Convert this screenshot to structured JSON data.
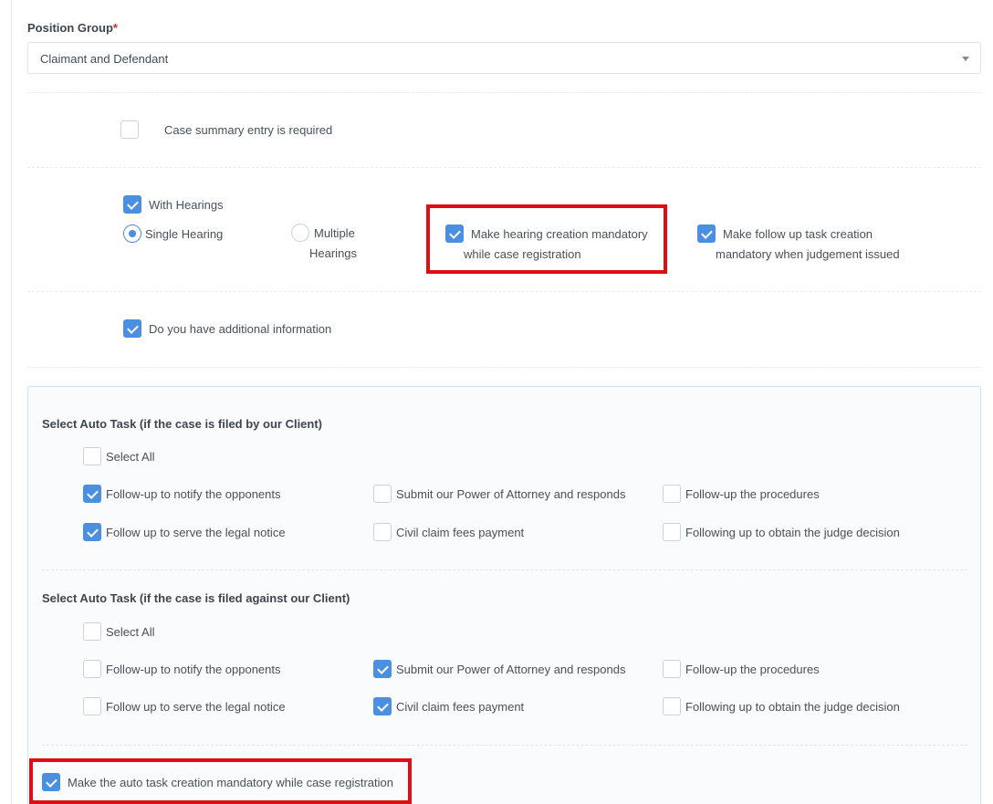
{
  "position_group": {
    "label": "Position Group",
    "required_mark": "*",
    "selected": "Claimant and Defendant"
  },
  "case_summary": {
    "label": "Case summary entry is required",
    "checked": false
  },
  "hearings": {
    "with_hearings": {
      "label": "With Hearings",
      "checked": true
    },
    "single_hearing": {
      "label": "Single Hearing",
      "selected": true
    },
    "multiple_hearings": {
      "line1": "Multiple",
      "line2": "Hearings",
      "selected": false
    },
    "mandatory_hearing": {
      "line1": "Make hearing creation mandatory",
      "line2": "while case registration",
      "checked": true
    },
    "mandatory_followup": {
      "line1": "Make follow up task creation",
      "line2": "mandatory when judgement issued",
      "checked": true
    }
  },
  "additional_info": {
    "label": "Do you have additional information",
    "checked": true
  },
  "auto_task_by_client": {
    "heading": "Select Auto Task (if the case is filed by our Client)",
    "select_all": {
      "label": "Select All",
      "checked": false
    },
    "tasks": [
      {
        "label": "Follow-up to notify the opponents",
        "checked": true
      },
      {
        "label": "Submit our Power of Attorney and responds",
        "checked": false
      },
      {
        "label": "Follow-up the procedures",
        "checked": false
      },
      {
        "label": "Follow up to serve the legal notice",
        "checked": true
      },
      {
        "label": "Civil claim fees payment",
        "checked": false
      },
      {
        "label": "Following up to obtain the judge decision",
        "checked": false
      }
    ]
  },
  "auto_task_against_client": {
    "heading": "Select Auto Task (if the case is filed against our Client)",
    "select_all": {
      "label": "Select All",
      "checked": false
    },
    "tasks": [
      {
        "label": "Follow-up to notify the opponents",
        "checked": false
      },
      {
        "label": "Submit our Power of Attorney and responds",
        "checked": true
      },
      {
        "label": "Follow-up the procedures",
        "checked": false
      },
      {
        "label": "Follow up to serve the legal notice",
        "checked": false
      },
      {
        "label": "Civil claim fees payment",
        "checked": true
      },
      {
        "label": "Following up to obtain the judge decision",
        "checked": false
      }
    ]
  },
  "auto_task_mandatory": {
    "label": "Make the auto task creation mandatory while case registration",
    "checked": true
  },
  "colors": {
    "accent": "#4b8fe0",
    "highlight": "#e00d15"
  }
}
